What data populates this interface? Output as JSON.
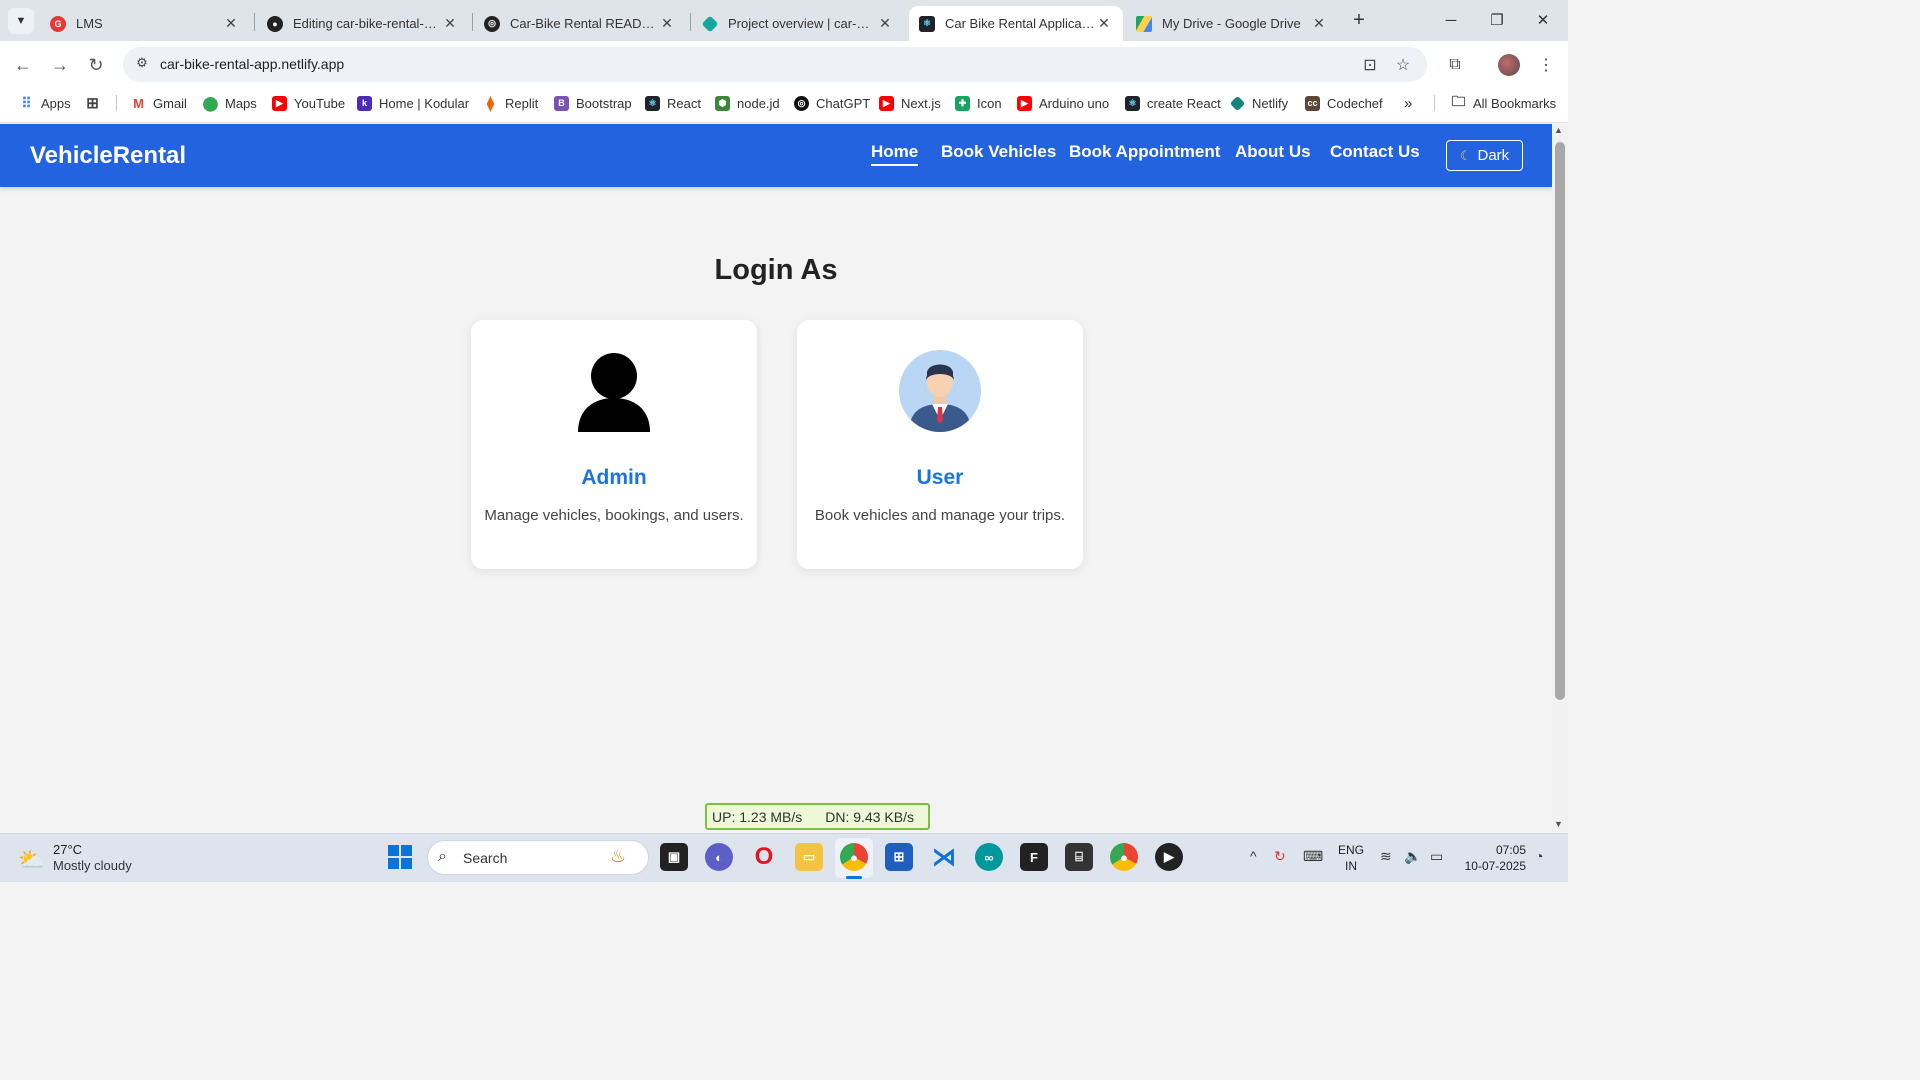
{
  "browser": {
    "tabs": [
      {
        "title": "LMS",
        "icon": "lms-icon"
      },
      {
        "title": "Editing car-bike-rental-app",
        "icon": "github-icon"
      },
      {
        "title": "Car-Bike Rental README",
        "icon": "chatgpt-icon"
      },
      {
        "title": "Project overview | car-bike",
        "icon": "netlify-icon"
      },
      {
        "title": "Car Bike Rental Application",
        "icon": "react-icon"
      },
      {
        "title": "My Drive - Google Drive",
        "icon": "google-drive-icon"
      }
    ],
    "url": "car-bike-rental-app.netlify.app",
    "bookmarks": [
      {
        "label": "Apps",
        "icon": "apps-grid-icon",
        "color": "#4285f4"
      },
      {
        "label": "",
        "icon": "tab-groups-icon",
        "color": "#444444"
      },
      {
        "label": "Gmail",
        "icon": "gmail-icon",
        "color": "#ea4335"
      },
      {
        "label": "Maps",
        "icon": "maps-icon",
        "color": "#34a853"
      },
      {
        "label": "YouTube",
        "icon": "youtube-icon",
        "color": "#ff0000"
      },
      {
        "label": "Home | Kodular",
        "icon": "kodular-icon",
        "color": "#4b2bb8"
      },
      {
        "label": "Replit",
        "icon": "replit-icon",
        "color": "#f26207"
      },
      {
        "label": "Bootstrap",
        "icon": "bootstrap-icon",
        "color": "#7952b3"
      },
      {
        "label": "React",
        "icon": "react-icon",
        "color": "#20232a"
      },
      {
        "label": "node.jd",
        "icon": "nodejs-icon",
        "color": "#3c873a"
      },
      {
        "label": "ChatGPT",
        "icon": "chatgpt-icon",
        "color": "#111111"
      },
      {
        "label": "Next.js",
        "icon": "youtube-icon",
        "color": "#ff0000"
      },
      {
        "label": "Icon",
        "icon": "icon-site-icon",
        "color": "#1aa260"
      },
      {
        "label": "Arduino uno",
        "icon": "youtube-icon",
        "color": "#ff0000"
      },
      {
        "label": "create React",
        "icon": "react-icon",
        "color": "#20232a"
      },
      {
        "label": "Netlify",
        "icon": "netlify-icon",
        "color": "#15847d"
      },
      {
        "label": "Codechef",
        "icon": "codechef-icon",
        "color": "#5b4638"
      }
    ],
    "all_bookmarks": "All Bookmarks"
  },
  "app": {
    "brand": "VehicleRental",
    "nav": [
      "Home",
      "Book Vehicles",
      "Book Appointment",
      "About Us",
      "Contact Us"
    ],
    "active_nav": "Home",
    "theme_toggle": "Dark",
    "heading": "Login As",
    "cards": [
      {
        "title": "Admin",
        "description": "Manage vehicles, bookings, and users.",
        "icon": "admin-person-icon"
      },
      {
        "title": "User",
        "description": "Book vehicles and manage your trips.",
        "icon": "user-avatar-icon"
      }
    ],
    "accent": "#2463e0",
    "title_color": "#1976e0"
  },
  "net_meter": {
    "up": "UP: 1.23 MB/s",
    "down": "DN: 9.43 KB/s"
  },
  "taskbar": {
    "weather_temp": "27°C",
    "weather_desc": "Mostly cloudy",
    "search_placeholder": "Search",
    "lang_top": "ENG",
    "lang_bottom": "IN",
    "time": "07:05",
    "date": "10-07-2025"
  }
}
